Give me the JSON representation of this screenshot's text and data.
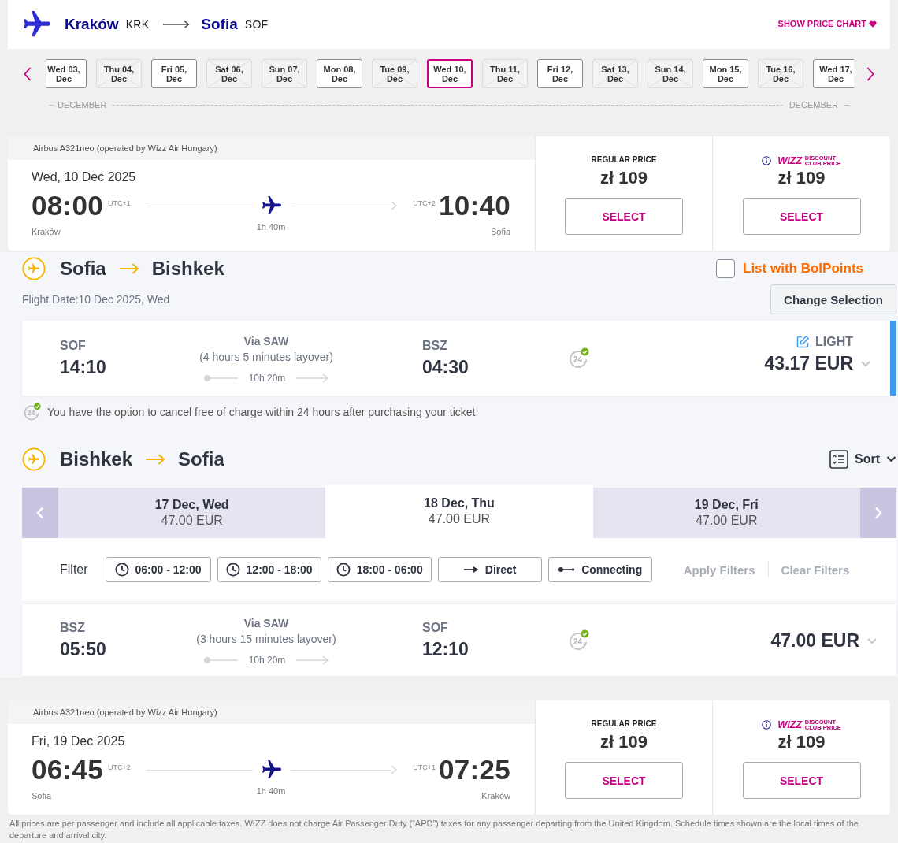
{
  "route_header": {
    "origin": {
      "city": "Kraków",
      "code": "KRK"
    },
    "destination": {
      "city": "Sofia",
      "code": "SOF"
    },
    "price_chart_link": "SHOW PRICE CHART"
  },
  "date_strip": {
    "days": [
      {
        "day": "Wed 03,",
        "month": "Dec",
        "disabled": false,
        "selected": false
      },
      {
        "day": "Thu 04,",
        "month": "Dec",
        "disabled": true,
        "selected": false
      },
      {
        "day": "Fri 05,",
        "month": "Dec",
        "disabled": false,
        "selected": false
      },
      {
        "day": "Sat 06,",
        "month": "Dec",
        "disabled": true,
        "selected": false
      },
      {
        "day": "Sun 07,",
        "month": "Dec",
        "disabled": true,
        "selected": false
      },
      {
        "day": "Mon 08,",
        "month": "Dec",
        "disabled": false,
        "selected": false
      },
      {
        "day": "Tue 09,",
        "month": "Dec",
        "disabled": true,
        "selected": false
      },
      {
        "day": "Wed 10,",
        "month": "Dec",
        "disabled": false,
        "selected": true
      },
      {
        "day": "Thu 11,",
        "month": "Dec",
        "disabled": true,
        "selected": false
      },
      {
        "day": "Fri 12,",
        "month": "Dec",
        "disabled": false,
        "selected": false
      },
      {
        "day": "Sat 13,",
        "month": "Dec",
        "disabled": true,
        "selected": false
      },
      {
        "day": "Sun 14,",
        "month": "Dec",
        "disabled": true,
        "selected": false
      },
      {
        "day": "Mon 15,",
        "month": "Dec",
        "disabled": false,
        "selected": false
      },
      {
        "day": "Tue 16,",
        "month": "Dec",
        "disabled": true,
        "selected": false
      },
      {
        "day": "Wed 17,",
        "month": "Dec",
        "disabled": false,
        "selected": false
      }
    ],
    "month_labels": [
      "DECEMBER",
      "DECEMBER"
    ]
  },
  "outbound_card": {
    "aircraft": "Airbus A321neo (operated by Wizz Air Hungary)",
    "date": "Wed, 10 Dec 2025",
    "departure": {
      "time": "08:00",
      "utc": "UTC+1",
      "city": "Kraków"
    },
    "duration": "1h 40m",
    "arrival": {
      "utc": "UTC+2",
      "time": "10:40",
      "city": "Sofia"
    },
    "fares": [
      {
        "kind": "regular",
        "label": "REGULAR PRICE",
        "price": "zł 109",
        "button": "SELECT"
      },
      {
        "kind": "club",
        "logo": "WIZZ",
        "label_lines": [
          "DISCOUNT",
          "CLUB PRICE"
        ],
        "price": "zł 109",
        "button": "SELECT"
      }
    ]
  },
  "outbound_connection": {
    "origin": "Sofia",
    "destination": "Bishkek",
    "bolpoints": {
      "label": "List with BolPoints",
      "checked": false
    },
    "flight_date": "Flight Date:10 Dec 2025, Wed",
    "change_button": "Change Selection",
    "flight": {
      "from_code": "SOF",
      "dep_time": "14:10",
      "via": "Via SAW",
      "layover": "(4 hours 5 minutes layover)",
      "duration": "10h 20m",
      "to_code": "BSZ",
      "arr_time": "04:30",
      "badge": "24",
      "fare": "LIGHT",
      "price": "43.17 EUR",
      "selected": true
    },
    "cancel_note": {
      "badge": "24",
      "text": "You have the option to cancel free of charge within 24 hours after purchasing your ticket."
    }
  },
  "return_connection": {
    "origin": "Bishkek",
    "destination": "Sofia",
    "sort": "Sort",
    "date_tabs": [
      {
        "date": "17 Dec, Wed",
        "price": "47.00 EUR",
        "selected": false
      },
      {
        "date": "18 Dec, Thu",
        "price": "47.00 EUR",
        "selected": true
      },
      {
        "date": "19 Dec, Fri",
        "price": "47.00 EUR",
        "selected": false
      }
    ],
    "filter": {
      "label": "Filter",
      "chips": [
        {
          "kind": "time",
          "label": "06:00 - 12:00"
        },
        {
          "kind": "time",
          "label": "12:00 - 18:00"
        },
        {
          "kind": "time",
          "label": "18:00 - 06:00"
        },
        {
          "kind": "direct",
          "label": "Direct"
        },
        {
          "kind": "connecting",
          "label": "Connecting"
        }
      ],
      "actions": [
        {
          "label": "Apply Filters",
          "disabled": true
        },
        {
          "label": "Clear Filters",
          "disabled": true
        }
      ]
    },
    "flights": [
      {
        "from_code": "BSZ",
        "dep_time": "05:50",
        "via": "Via SAW",
        "layover": "(3 hours 15 minutes layover)",
        "duration": "10h 20m",
        "to_code": "SOF",
        "arr_time": "12:10",
        "badge": "24",
        "price": "47.00 EUR",
        "selected": false
      }
    ]
  },
  "return_card": {
    "aircraft": "Airbus A321neo (operated by Wizz Air Hungary)",
    "date": "Fri, 19 Dec 2025",
    "departure": {
      "time": "06:45",
      "utc": "UTC+2",
      "city": "Sofia"
    },
    "duration": "1h 40m",
    "arrival": {
      "utc": "UTC+1",
      "time": "07:25",
      "city": "Kraków"
    },
    "fares": [
      {
        "kind": "regular",
        "label": "REGULAR PRICE",
        "price": "zł 109",
        "button": "SELECT"
      },
      {
        "kind": "club",
        "logo": "WIZZ",
        "label_lines": [
          "DISCOUNT",
          "CLUB PRICE"
        ],
        "price": "zł 109",
        "button": "SELECT"
      }
    ]
  },
  "footer_note": "All prices are per passenger and include all applicable taxes. WIZZ does not charge Air Passenger Duty (“APD”) taxes for any passenger departing from the United Kingdom. Schedule times shown are the local times of the departure and arrival city."
}
